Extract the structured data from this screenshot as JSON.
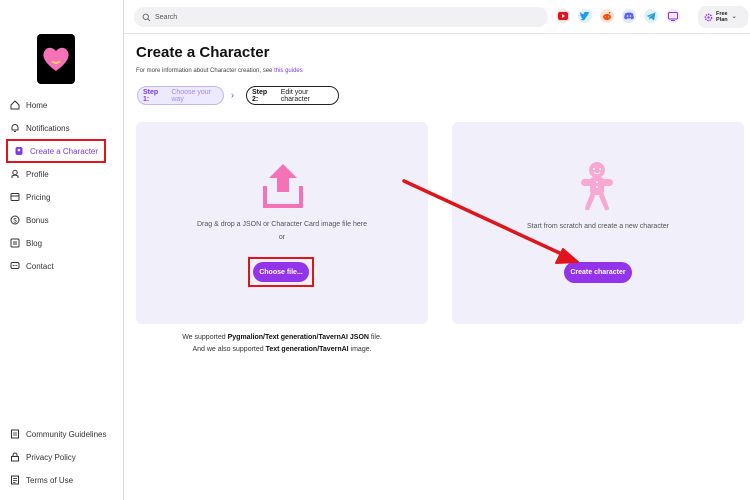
{
  "sidebar": {
    "items": [
      {
        "label": "Home",
        "icon": "home-icon"
      },
      {
        "label": "Notifications",
        "icon": "bell-icon"
      },
      {
        "label": "Create a Character",
        "icon": "character-icon"
      },
      {
        "label": "Profile",
        "icon": "profile-icon"
      },
      {
        "label": "Pricing",
        "icon": "pricing-icon"
      },
      {
        "label": "Bonus",
        "icon": "coin-icon"
      },
      {
        "label": "Blog",
        "icon": "blog-icon"
      },
      {
        "label": "Contact",
        "icon": "contact-icon"
      }
    ],
    "footer_items": [
      {
        "label": "Community Guidelines",
        "icon": "document-icon"
      },
      {
        "label": "Privacy Policy",
        "icon": "lock-icon"
      },
      {
        "label": "Terms of Use",
        "icon": "terms-icon"
      }
    ],
    "active_index": 2
  },
  "topbar": {
    "search_placeholder": "Search",
    "social_icons": [
      "youtube-icon",
      "twitter-icon",
      "reddit-icon",
      "discord-icon",
      "telegram-icon",
      "tv-icon"
    ],
    "plan_line1": "Free",
    "plan_line2": "Plan"
  },
  "main": {
    "title": "Create a Character",
    "subtitle_prefix": "For more information about Character creation, see ",
    "subtitle_link": "this guides",
    "steps": [
      {
        "num": "Step 1:",
        "label": "Choose your way"
      },
      {
        "num": "Step 2:",
        "label": "Edit your character"
      }
    ],
    "upload": {
      "drop_text": "Drag & drop a JSON or Character Card image file here",
      "or_text": "or",
      "button_label": "Choose file..."
    },
    "scratch": {
      "text": "Start from scratch and create a new character",
      "button_label": "Create character"
    },
    "support": {
      "line1_prefix": "We supported ",
      "line1_bold": "Pygmalion/Text generation/TavernAI JSON",
      "line1_suffix": " file.",
      "line2_prefix": "And we also supported ",
      "line2_bold": "Text generation/TavernAI",
      "line2_suffix": " image."
    }
  },
  "colors": {
    "accent": "#9333ea",
    "highlight_red": "#e0141b",
    "panel_bg": "#f1f0fa",
    "pink": "#f472b6"
  }
}
